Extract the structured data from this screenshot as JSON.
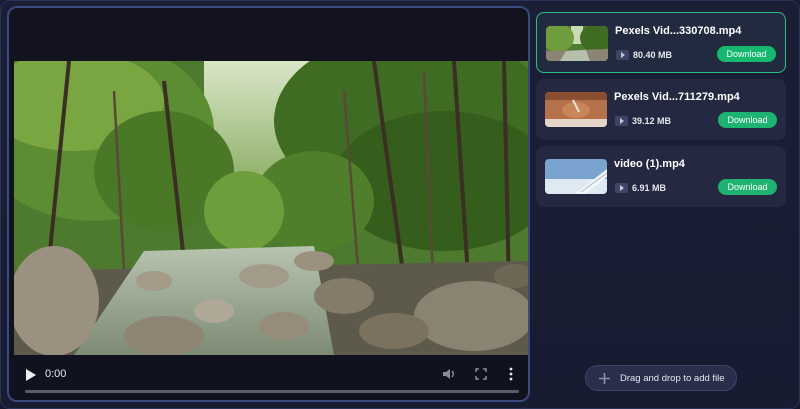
{
  "player": {
    "current_time": "0:00",
    "progress_fraction": 0
  },
  "files": [
    {
      "name": "Pexels Vid...330708.mp4",
      "size": "80.40 MB",
      "download_label": "Download",
      "active": true
    },
    {
      "name": "Pexels Vid...711279.mp4",
      "size": "39.12 MB",
      "download_label": "Download",
      "active": false
    },
    {
      "name": "video (1).mp4",
      "size": "6.91 MB",
      "download_label": "Download",
      "active": false
    }
  ],
  "add_file": {
    "label": "Drag and drop to add file",
    "icon": "plus-icon"
  },
  "colors": {
    "background": "#1b1f36",
    "card": "#242841",
    "active_border": "#2dbd8a",
    "download_green": "#1fb371",
    "player_border": "#3a4a7e"
  }
}
